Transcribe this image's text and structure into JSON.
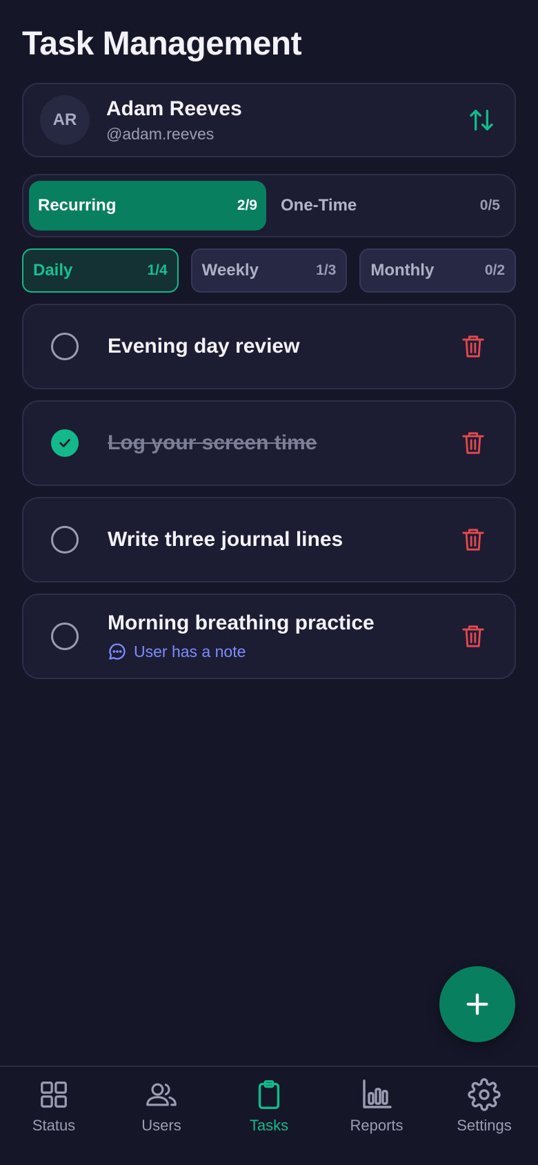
{
  "page": {
    "title": "Task Management"
  },
  "user": {
    "initials": "AR",
    "name": "Adam Reeves",
    "handle": "@adam.reeves",
    "swap_icon": "arrows-up-down-icon"
  },
  "segments": [
    {
      "label": "Recurring",
      "count": "2/9",
      "active": true
    },
    {
      "label": "One-Time",
      "count": "0/5",
      "active": false
    }
  ],
  "filters": [
    {
      "label": "Daily",
      "count": "1/4",
      "active": true
    },
    {
      "label": "Weekly",
      "count": "1/3",
      "active": false
    },
    {
      "label": "Monthly",
      "count": "0/2",
      "active": false
    }
  ],
  "tasks": [
    {
      "title": "Evening day review",
      "done": false,
      "note": ""
    },
    {
      "title": "Log your screen time",
      "done": true,
      "note": ""
    },
    {
      "title": "Write three journal lines",
      "done": false,
      "note": ""
    },
    {
      "title": "Morning breathing practice",
      "done": false,
      "note": "User has a note"
    }
  ],
  "fab": {
    "icon": "plus-icon"
  },
  "nav": [
    {
      "label": "Status",
      "icon": "grid-icon",
      "active": false
    },
    {
      "label": "Users",
      "icon": "users-icon",
      "active": false
    },
    {
      "label": "Tasks",
      "icon": "clipboard-icon",
      "active": true
    },
    {
      "label": "Reports",
      "icon": "bar-chart-icon",
      "active": false
    },
    {
      "label": "Settings",
      "icon": "gear-icon",
      "active": false
    }
  ],
  "colors": {
    "background": "#151628",
    "card": "#1c1d33",
    "accent": "#08805f",
    "accent_bright": "#13b98a",
    "danger": "#e5484d",
    "link": "#7d8cff"
  }
}
